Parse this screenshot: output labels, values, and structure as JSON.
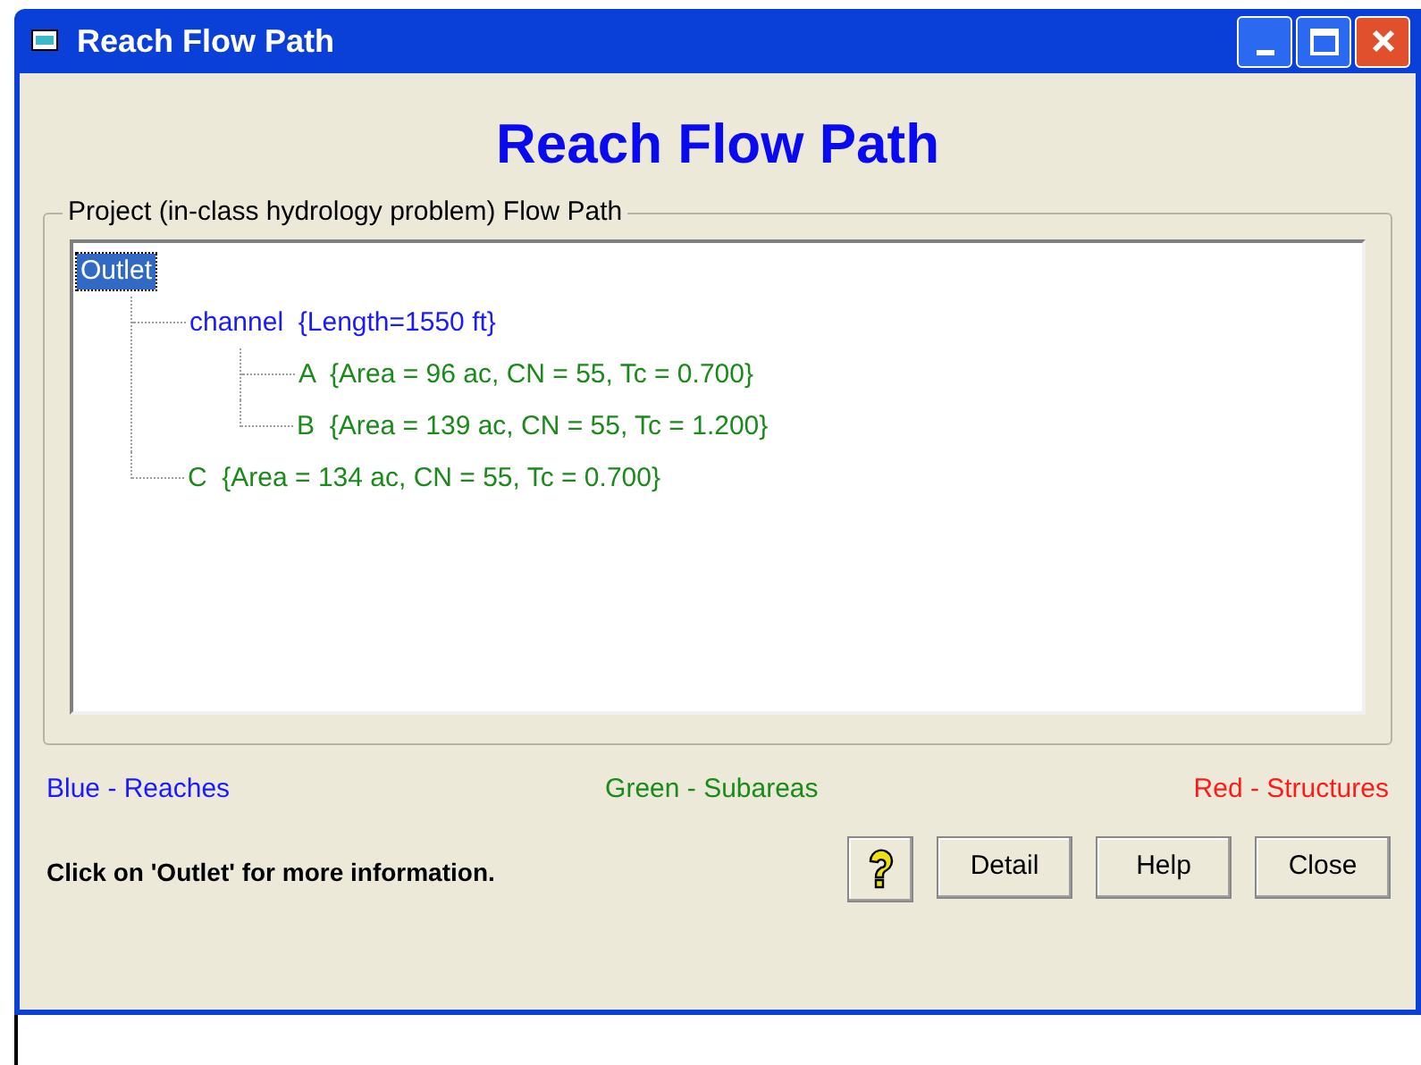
{
  "window": {
    "title": "Reach Flow Path"
  },
  "heading": "Reach Flow Path",
  "group": {
    "label": "Project (in-class hydrology problem) Flow Path",
    "tree": [
      {
        "label": "Outlet",
        "selected": true,
        "children": [
          {
            "label": "channel  {Length=1550 ft}",
            "kind": "reach",
            "selected": false,
            "children": [
              {
                "label": "A  {Area = 96 ac, CN = 55, Tc = 0.700}",
                "kind": "subarea",
                "selected": false
              },
              {
                "label": "B  {Area = 139 ac, CN = 55, Tc = 1.200}",
                "kind": "subarea",
                "selected": false
              }
            ]
          },
          {
            "label": "C  {Area = 134 ac, CN = 55, Tc = 0.700}",
            "kind": "subarea",
            "selected": false
          }
        ]
      }
    ]
  },
  "legend": [
    {
      "label": "Blue - Reaches",
      "color": "#1a1aff"
    },
    {
      "label": "Green - Subareas",
      "color": "#1a8a1a"
    },
    {
      "label": "Red - Structures",
      "color": "#ff1a1a"
    }
  ],
  "hint": "Click on 'Outlet' for more information.",
  "buttons": [
    {
      "label": "Detail"
    },
    {
      "label": "Help"
    },
    {
      "label": "Close"
    }
  ]
}
